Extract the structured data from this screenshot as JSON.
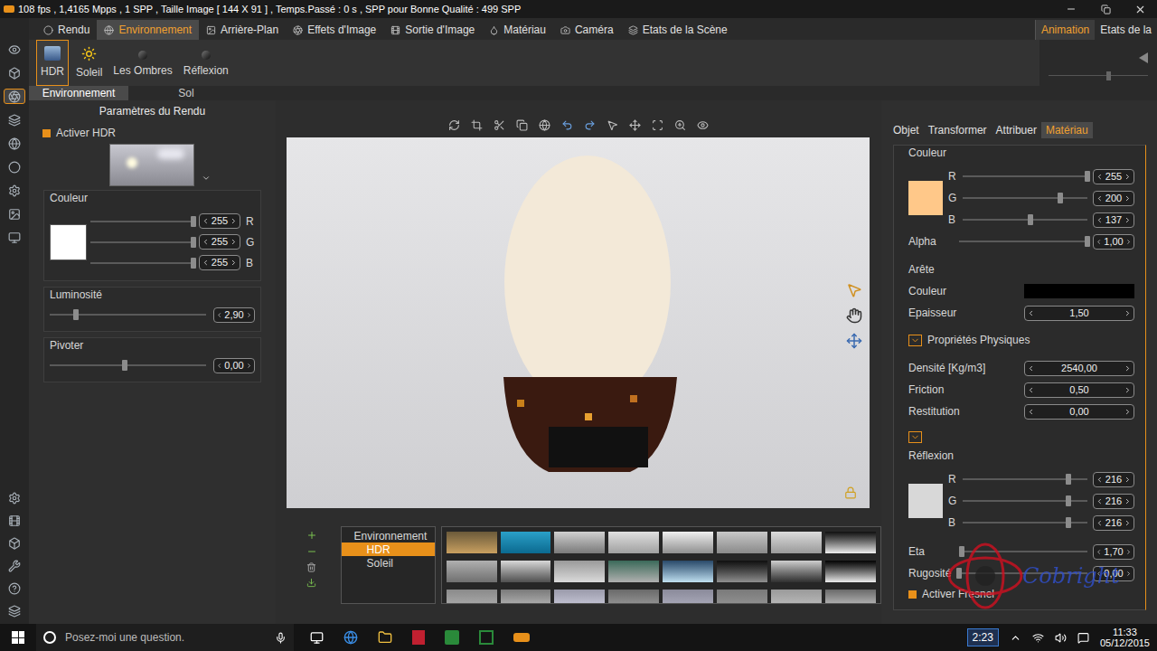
{
  "window": {
    "title": "108 fps , 1,4165 Mpps , 1 SPP , Taille Image [ 144 X 91 ] , Temps.Passé : 0 s , SPP pour Bonne Qualité : 499 SPP"
  },
  "menu_tabs": [
    {
      "label": "Rendu",
      "selected": false
    },
    {
      "label": "Environnement",
      "selected": true
    },
    {
      "label": "Arrière-Plan",
      "selected": false
    },
    {
      "label": "Effets d'Image",
      "selected": false
    },
    {
      "label": "Sortie d'Image",
      "selected": false
    },
    {
      "label": "Matériau",
      "selected": false
    },
    {
      "label": "Caméra",
      "selected": false
    },
    {
      "label": "Etats de la Scène",
      "selected": false
    }
  ],
  "side_tabs": [
    {
      "label": "Animation",
      "selected": true
    },
    {
      "label": "Etats de la",
      "selected": false
    }
  ],
  "ribbon": [
    {
      "label": "HDR",
      "selected": true
    },
    {
      "label": "Soleil",
      "selected": false
    },
    {
      "label": "Les Ombres",
      "selected": false
    },
    {
      "label": "Réflexion",
      "selected": false
    }
  ],
  "sub_tabs": [
    {
      "label": "Environnement",
      "selected": true
    },
    {
      "label": "Sol",
      "selected": false
    }
  ],
  "left_panel": {
    "title": "Paramètres du Rendu",
    "hdr": {
      "label": "Activer HDR",
      "checked": true
    },
    "color": {
      "label": "Couleur",
      "channels": [
        {
          "name": "R",
          "value": "255",
          "level": 1
        },
        {
          "name": "G",
          "value": "255",
          "level": 1
        },
        {
          "name": "B",
          "value": "255",
          "level": 1
        }
      ]
    },
    "luminosity": {
      "label": "Luminosité",
      "value": "2,90",
      "level": 0.17
    },
    "rotate": {
      "label": "Pivoter",
      "value": "0,00",
      "level": 0.48
    }
  },
  "scene_tree": [
    {
      "label": "Environnement",
      "kind": "group",
      "selected": false
    },
    {
      "label": "HDR",
      "kind": "child",
      "selected": true
    },
    {
      "label": "Soleil",
      "kind": "child",
      "selected": false
    }
  ],
  "right_panel": {
    "tabs": [
      {
        "label": "Objet",
        "selected": false
      },
      {
        "label": "Transformer",
        "selected": false
      },
      {
        "label": "Attribuer",
        "selected": false
      },
      {
        "label": "Matériau",
        "selected": true
      }
    ],
    "color": {
      "label": "Couleur",
      "channels": [
        {
          "name": "R",
          "value": "255",
          "level": 1
        },
        {
          "name": "G",
          "value": "200",
          "level": 0.78
        },
        {
          "name": "B",
          "value": "137",
          "level": 0.54
        }
      ],
      "alpha": {
        "label": "Alpha",
        "value": "1,00",
        "level": 1
      }
    },
    "edge": {
      "title": "Arête",
      "color_label": "Couleur",
      "color": "#000000",
      "thickness_label": "Epaisseur",
      "thickness": "1,50"
    },
    "physical": {
      "title": "Propriétés Physiques",
      "expanded": true,
      "fields": [
        {
          "label": "Densité [Kg/m3]",
          "value": "2540,00"
        },
        {
          "label": "Friction",
          "value": "0,50"
        },
        {
          "label": "Restitution",
          "value": "0,00"
        }
      ]
    },
    "reflection": {
      "title": "Réflexion",
      "expanded": true,
      "channels": [
        {
          "name": "R",
          "value": "216",
          "level": 0.85
        },
        {
          "name": "G",
          "value": "216",
          "level": 0.85
        },
        {
          "name": "B",
          "value": "216",
          "level": 0.85
        }
      ]
    },
    "eta": {
      "label": "Eta",
      "value": "1,70",
      "level": 0.02
    },
    "roughness": {
      "label": "Rugosité",
      "value": "0,00",
      "level": 0
    },
    "fresnel": {
      "label": "Activer Fresnel",
      "checked": true
    }
  },
  "watermark": "Cobright",
  "taskbar": {
    "search": "Posez-moi une question.",
    "badge": "2:23",
    "time": "11:33",
    "date": "05/12/2015"
  }
}
